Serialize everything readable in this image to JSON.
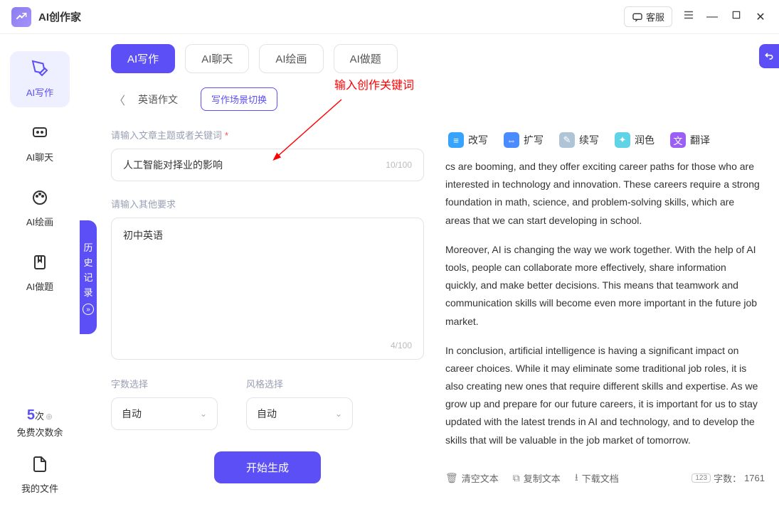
{
  "app": {
    "title": "AI创作家",
    "support": "客服"
  },
  "sidebar": {
    "items": [
      {
        "label": "AI写作"
      },
      {
        "label": "AI聊天"
      },
      {
        "label": "AI绘画"
      },
      {
        "label": "AI做题"
      }
    ],
    "quota": {
      "num": "5",
      "times": "次",
      "label": "免费次数余"
    },
    "myfiles": "我的文件"
  },
  "history": {
    "label": "历史记录"
  },
  "tabs": [
    {
      "label": "AI写作"
    },
    {
      "label": "AI聊天"
    },
    {
      "label": "AI绘画"
    },
    {
      "label": "AI做题"
    }
  ],
  "breadcrumb": {
    "text": "英语作文",
    "switch": "写作场景切换"
  },
  "annotation": "输入创作关键词",
  "form": {
    "topic_label": "请输入文章主题或者关键词",
    "topic_value": "人工智能对择业的影响",
    "topic_counter": "10/100",
    "extra_label": "请输入其他要求",
    "extra_value": "初中英语",
    "extra_counter": "4/100",
    "words_label": "字数选择",
    "words_value": "自动",
    "style_label": "风格选择",
    "style_value": "自动",
    "generate": "开始生成"
  },
  "tools": [
    {
      "label": "改写"
    },
    {
      "label": "扩写"
    },
    {
      "label": "续写"
    },
    {
      "label": "润色"
    },
    {
      "label": "翻译"
    }
  ],
  "output": {
    "p1": "cs are booming, and they offer exciting career paths for those who are interested in technology and innovation. These careers require a strong foundation in math, science, and problem-solving skills, which are areas that we can start developing in school.",
    "p2": "Moreover, AI is changing the way we work together. With the help of AI tools, people can collaborate more effectively, share information quickly, and make better decisions. This means that teamwork and communication skills will become even more important in the future job market.",
    "p3": "In conclusion, artificial intelligence is having a significant impact on career choices. While it may eliminate some traditional job roles, it is also creating new ones that require different skills and expertise. As we grow up and prepare for our future careers, it is important for us to stay updated with the latest trends in AI and technology, and to develop the skills that will be valuable in the job market of tomorrow."
  },
  "footer": {
    "clear": "清空文本",
    "copy": "复制文本",
    "download": "下载文档",
    "wc_label": "字数：",
    "wc_value": "1761"
  }
}
